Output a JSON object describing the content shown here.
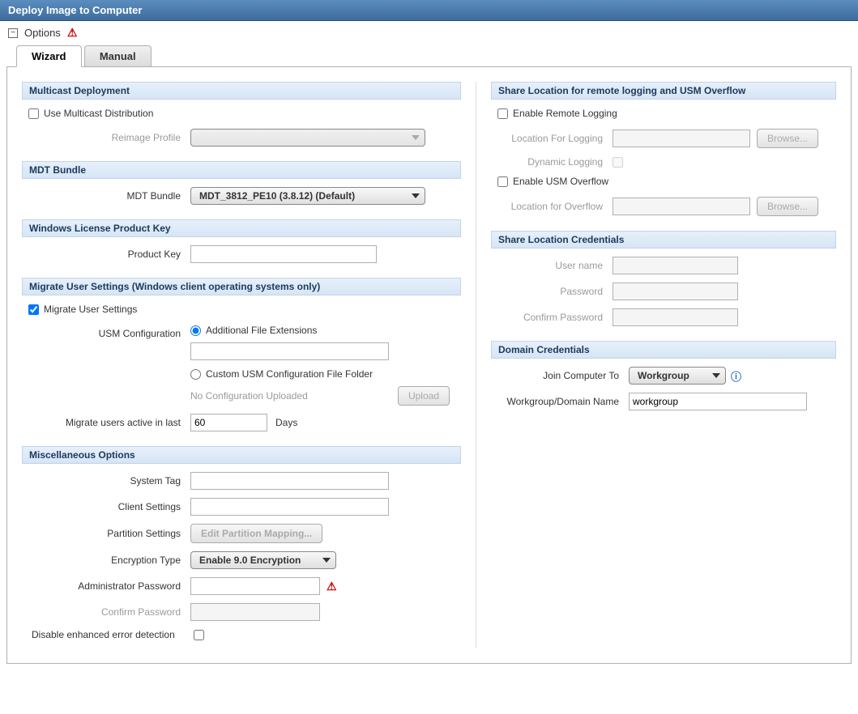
{
  "title": "Deploy Image to Computer",
  "options": "Options",
  "tabs": {
    "wizard": "Wizard",
    "manual": "Manual"
  },
  "left": {
    "multicast": {
      "header": "Multicast Deployment",
      "use_multicast": "Use Multicast Distribution",
      "reimage_profile_label": "Reimage Profile",
      "reimage_profile_value": ""
    },
    "mdt": {
      "header": "MDT Bundle",
      "label": "MDT Bundle",
      "value": "MDT_3812_PE10 (3.8.12) (Default)"
    },
    "license": {
      "header": "Windows License Product Key",
      "label": "Product Key",
      "value": ""
    },
    "migrate": {
      "header": "Migrate User Settings (Windows client operating systems only)",
      "checkbox": "Migrate User Settings",
      "usm_config_label": "USM Configuration",
      "radio_ext": "Additional File Extensions",
      "radio_custom": "Custom USM Configuration File Folder",
      "no_config": "No Configuration Uploaded",
      "upload_btn": "Upload",
      "days_label": "Migrate users active in last",
      "days_value": "60",
      "days_suffix": "Days"
    },
    "misc": {
      "header": "Miscellaneous Options",
      "system_tag": "System Tag",
      "client_settings": "Client Settings",
      "partition_label": "Partition Settings",
      "partition_btn": "Edit Partition Mapping...",
      "encryption_label": "Encryption Type",
      "encryption_value": "Enable 9.0 Encryption",
      "admin_password": "Administrator Password",
      "confirm_password": "Confirm Password",
      "disable_detection": "Disable enhanced error detection"
    }
  },
  "right": {
    "share": {
      "header": "Share Location for remote logging and USM Overflow",
      "enable_remote": "Enable Remote Logging",
      "loc_logging": "Location For Logging",
      "dynamic": "Dynamic Logging",
      "enable_usm": "Enable USM Overflow",
      "loc_overflow": "Location for Overflow",
      "browse": "Browse..."
    },
    "creds": {
      "header": "Share Location Credentials",
      "user": "User name",
      "pass": "Password",
      "confirm": "Confirm Password"
    },
    "domain": {
      "header": "Domain Credentials",
      "join_label": "Join Computer To",
      "join_value": "Workgroup",
      "name_label": "Workgroup/Domain Name",
      "name_value": "workgroup"
    }
  }
}
